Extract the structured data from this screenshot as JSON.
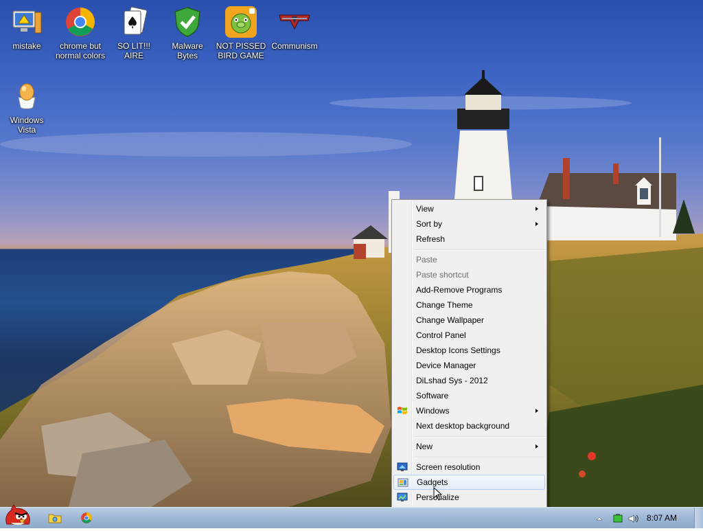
{
  "desktop_icons": [
    {
      "label": "mistake",
      "icon": "monitor-warning-icon"
    },
    {
      "label": "chrome but normal colors",
      "icon": "chrome-icon"
    },
    {
      "label": "SO LIT!!! AIRE",
      "icon": "solitaire-cards-icon"
    },
    {
      "label": "Malware Bytes",
      "icon": "shield-check-icon"
    },
    {
      "label": "NOT PISSED BIRD GAME",
      "icon": "green-pig-icon"
    },
    {
      "label": "Communism",
      "icon": "red-emblem-icon"
    },
    {
      "label": "Windows Vista",
      "icon": "egg-icon"
    }
  ],
  "context_menu": {
    "items": [
      {
        "label": "View",
        "submenu": true
      },
      {
        "label": "Sort by",
        "submenu": true
      },
      {
        "label": "Refresh"
      },
      {
        "label": "Paste",
        "disabled": true
      },
      {
        "label": "Paste shortcut",
        "disabled": true
      },
      {
        "label": "Add-Remove Programs"
      },
      {
        "label": "Change Theme"
      },
      {
        "label": "Change Wallpaper"
      },
      {
        "label": "Control Panel"
      },
      {
        "label": "Desktop Icons Settings"
      },
      {
        "label": "Device Manager"
      },
      {
        "label": "DiLshad Sys - 2012"
      },
      {
        "label": "Software"
      },
      {
        "label": "Windows",
        "submenu": true,
        "icon": "windows-flag-icon"
      },
      {
        "label": "Next desktop background"
      },
      {
        "label": "New",
        "submenu": true
      },
      {
        "label": "Screen resolution",
        "icon": "monitor-icon"
      },
      {
        "label": "Gadgets",
        "icon": "gadgets-icon",
        "highlighted": true
      },
      {
        "label": "Personalize",
        "icon": "personalize-icon"
      }
    ]
  },
  "taskbar": {
    "start_icon": "angry-bird-icon",
    "pinned": [
      "explorer-folder-icon",
      "chrome-icon"
    ],
    "tray_icons": [
      "show-hidden-icons-icon",
      "battery-icon",
      "volume-icon"
    ],
    "clock": "8:07 AM"
  }
}
